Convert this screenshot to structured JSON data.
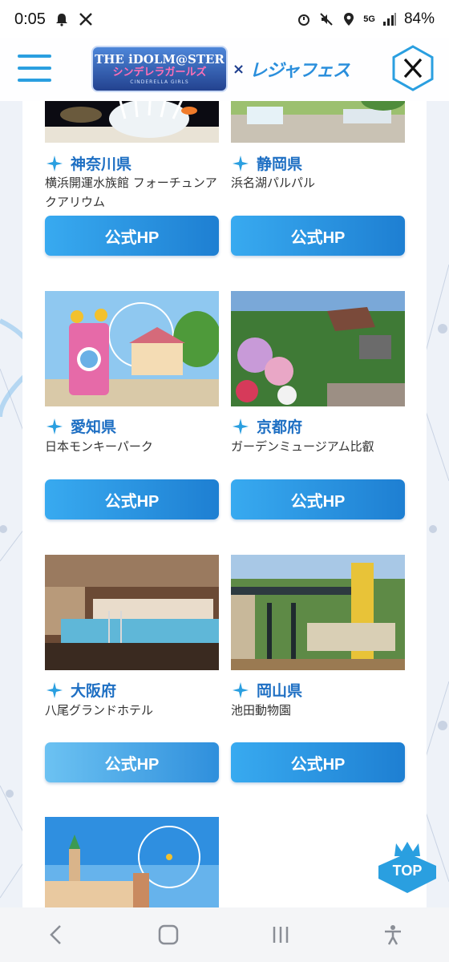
{
  "status_bar": {
    "time": "0:05",
    "network": "5G",
    "battery": "84%"
  },
  "header": {
    "logo_line1": "THE iDOLM@STER",
    "logo_line2": "シンデレラガールズ",
    "logo_line3": "CINDERELLA GIRLS",
    "cross": "×",
    "partner": "レジャフェス",
    "x_label": "𝕏"
  },
  "venues": [
    {
      "pref": "神奈川県",
      "name": "横浜開運水族館 フォーチュンアクアリウム",
      "button": "公式HP",
      "image": "aquarium-anemone-image"
    },
    {
      "pref": "静岡県",
      "name": "浜名湖パルパル",
      "button": "公式HP",
      "image": "ferris-wheel-park-image"
    },
    {
      "pref": "愛知県",
      "name": "日本モンキーパーク",
      "button": "公式HP",
      "image": "carousel-park-image"
    },
    {
      "pref": "京都府",
      "name": "ガーデンミュージアム比叡",
      "button": "公式HP",
      "image": "flower-garden-image"
    },
    {
      "pref": "大阪府",
      "name": "八尾グランドホテル",
      "button": "公式HP",
      "image": "hotel-bath-image"
    },
    {
      "pref": "岡山県",
      "name": "池田動物園",
      "button": "公式HP",
      "image": "zoo-entrance-image"
    }
  ],
  "partial_venue": {
    "image": "castle-ferris-wheel-image"
  },
  "top_button": "TOP",
  "colors": {
    "accent": "#2a9fe0",
    "pref_text": "#1e6fc3",
    "button": "#1e7fd2"
  }
}
